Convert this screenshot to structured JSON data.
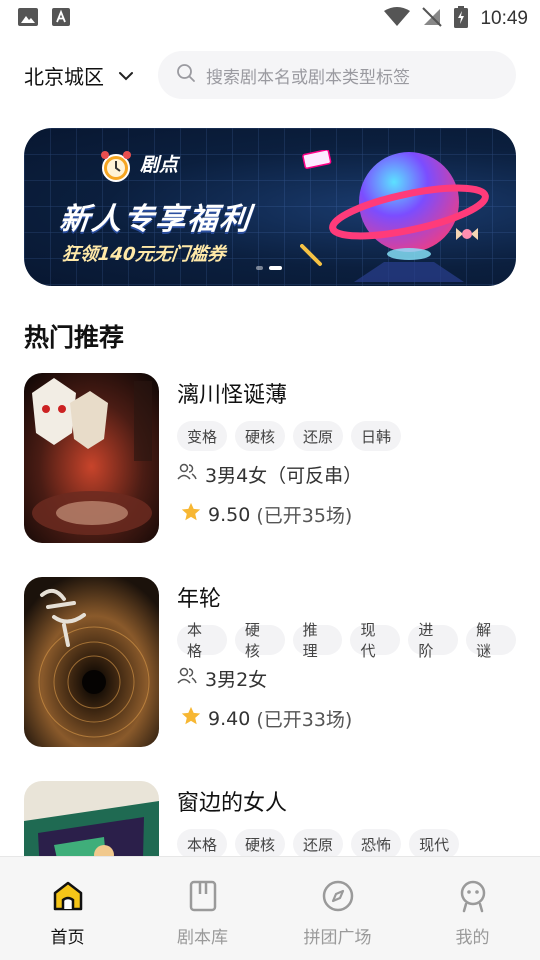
{
  "status_bar": {
    "time": "10:49",
    "left_icons": [
      "image-icon",
      "font-icon"
    ],
    "right_icons": [
      "wifi-icon",
      "no-signal-icon",
      "battery-charging-icon"
    ]
  },
  "header": {
    "city": "北京城区",
    "search_placeholder": "搜索剧本名或剧本类型标签"
  },
  "banner": {
    "brand": "剧点",
    "title": "新人专享福利",
    "subtitle": "狂领140元无门槛券",
    "dots_count": 2,
    "active_dot": 1
  },
  "section": {
    "title": "热门推荐"
  },
  "scripts": [
    {
      "title": "漓川怪诞薄",
      "tags": [
        "变格",
        "硬核",
        "还原",
        "日韩"
      ],
      "players": "3男4女（可反串）",
      "rating": "9.50",
      "sessions": "(已开35场)"
    },
    {
      "title": "年轮",
      "tags": [
        "本格",
        "硬核",
        "推理",
        "现代",
        "进阶",
        "解谜"
      ],
      "players": "3男2女",
      "rating": "9.40",
      "sessions": "(已开33场)"
    },
    {
      "title": "窗边的女人",
      "tags": [
        "本格",
        "硬核",
        "还原",
        "恐怖",
        "现代"
      ],
      "players": "",
      "rating": "",
      "sessions": ""
    }
  ],
  "tab_bar": {
    "tabs": [
      {
        "label": "首页",
        "icon": "home-icon",
        "active": true
      },
      {
        "label": "剧本库",
        "icon": "book-icon",
        "active": false
      },
      {
        "label": "拼团广场",
        "icon": "compass-icon",
        "active": false
      },
      {
        "label": "我的",
        "icon": "profile-icon",
        "active": false
      }
    ]
  },
  "colors": {
    "accent": "#f5c518",
    "star": "#f7b733",
    "tag_bg": "#f3f3f5",
    "inactive_tab": "#9a9a9a"
  }
}
